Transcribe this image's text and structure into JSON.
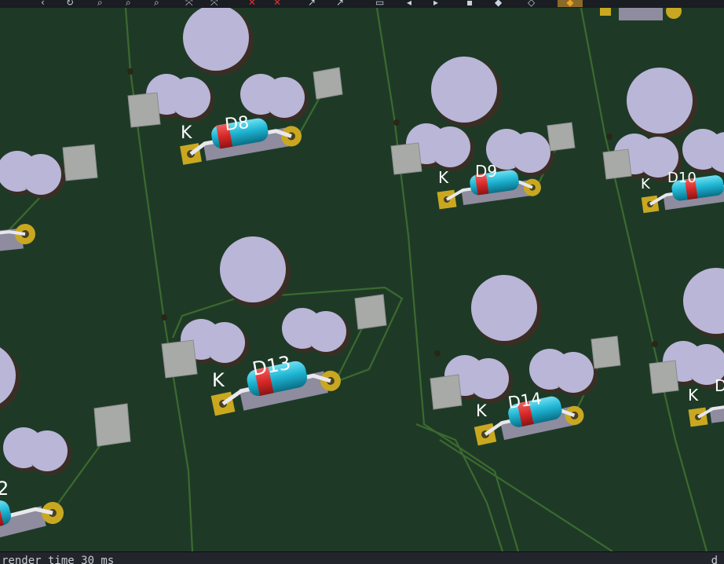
{
  "toolbar": {
    "buttons": [
      {
        "name": "prev-icon"
      },
      {
        "name": "rotate-icon"
      },
      {
        "name": "zoom-in-icon"
      },
      {
        "name": "zoom-out-icon"
      },
      {
        "name": "zoom-fit-icon"
      },
      {
        "name": "flip-x-icon"
      },
      {
        "name": "flip-y-icon"
      },
      {
        "name": "ratsnest-icon"
      },
      {
        "name": "ratsnest-alt-icon"
      },
      {
        "name": "axis-x-icon"
      },
      {
        "name": "axis-y-icon"
      },
      {
        "name": "layer-icon"
      },
      {
        "name": "arrow-left-icon"
      },
      {
        "name": "arrow-right-icon"
      },
      {
        "name": "fill-icon"
      },
      {
        "name": "shape-icon"
      },
      {
        "name": "cube-icon"
      },
      {
        "name": "active-tool-icon"
      }
    ],
    "accent": "#f0a020"
  },
  "board": {
    "colors": {
      "substrate": "#1e3a27",
      "trace": "#3c6a2e",
      "pad_gold": "#c9a820",
      "pad_square": "#a8aaa8",
      "hole": "#b9b6d8",
      "diode_body": "#1fb6d4",
      "diode_band": "#d82828",
      "silk": "#ffffff"
    },
    "diodes": [
      {
        "ref": "D8",
        "pin_label": "K"
      },
      {
        "ref": "D9",
        "pin_label": "K"
      },
      {
        "ref": "D10",
        "pin_label": "K"
      },
      {
        "ref": "D13",
        "pin_label": "K"
      },
      {
        "ref": "D14",
        "pin_label": "K"
      },
      {
        "ref": "2",
        "pin_label": ""
      },
      {
        "ref": "D",
        "pin_label": "K"
      }
    ]
  },
  "status": {
    "left_text": "render time 30 ms",
    "right_text": "d"
  }
}
